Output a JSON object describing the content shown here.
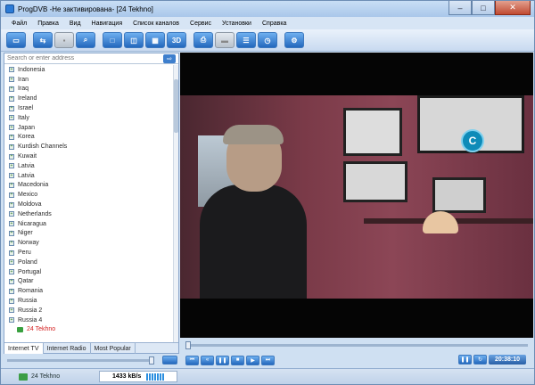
{
  "window": {
    "title": "ProgDVB -Не зактивирована- [24 Tekhno]",
    "buttons": [
      "–",
      "□",
      "✕"
    ]
  },
  "menu": [
    "Файл",
    "Правка",
    "Вид",
    "Навигация",
    "Список каналов",
    "Сервис",
    "Установки",
    "Справка"
  ],
  "search": {
    "placeholder": "Search or enter address"
  },
  "channels": [
    "Indonesia",
    "Iran",
    "Iraq",
    "Ireland",
    "Israel",
    "Italy",
    "Japan",
    "Korea",
    "Kurdish Channels",
    "Kuwait",
    "Latvia",
    "Latvia",
    "Macedonia",
    "Mexico",
    "Moldova",
    "Netherlands",
    "Nicaragua",
    "Niger",
    "Norway",
    "Peru",
    "Poland",
    "Portugal",
    "Qatar",
    "Romania",
    "Russia",
    "Russia 2",
    "Russia 4"
  ],
  "selected_channel": "24 Tekhno",
  "tabs": [
    "Internet TV",
    "Internet Radio",
    "Most Popular"
  ],
  "volume": {
    "level": 1.0
  },
  "seek": {
    "position": 0.0
  },
  "time": "20:38:10",
  "status": {
    "channel": "24 Tekhno",
    "bitrate": "1433 kB/s"
  },
  "colors": {
    "accent": "#2368bd",
    "selected": "#d42020",
    "video_bg": "#050505"
  }
}
